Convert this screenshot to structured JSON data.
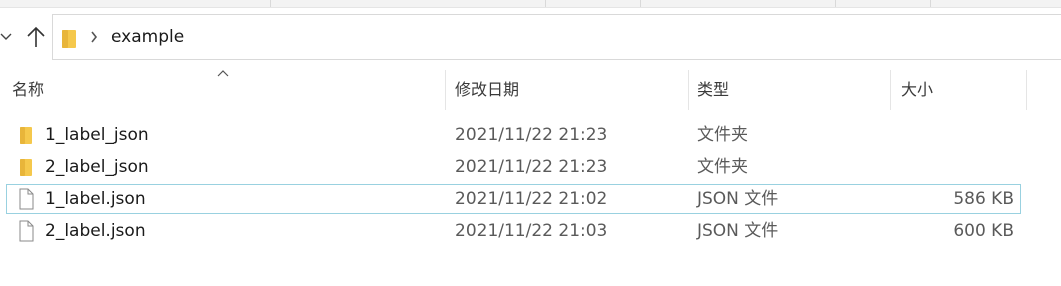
{
  "window": {
    "address": {
      "path": "example"
    }
  },
  "columns": {
    "name": "名称",
    "date": "修改日期",
    "type": "类型",
    "size": "大小"
  },
  "files": [
    {
      "name": "1_label_json",
      "date": "2021/11/22 21:23",
      "type": "文件夹",
      "size": "",
      "icon": "folder-icon"
    },
    {
      "name": "2_label_json",
      "date": "2021/11/22 21:23",
      "type": "文件夹",
      "size": "",
      "icon": "folder-icon"
    },
    {
      "name": "1_label.json",
      "date": "2021/11/22 21:02",
      "type": "JSON 文件",
      "size": "586 KB",
      "icon": "file-icon"
    },
    {
      "name": "2_label.json",
      "date": "2021/11/22 21:03",
      "type": "JSON 文件",
      "size": "600 KB",
      "icon": "file-icon"
    }
  ],
  "colors": {
    "folder": "#f5c84c",
    "focus_border": "#99d1e0",
    "divider": "#e5e5e5"
  }
}
